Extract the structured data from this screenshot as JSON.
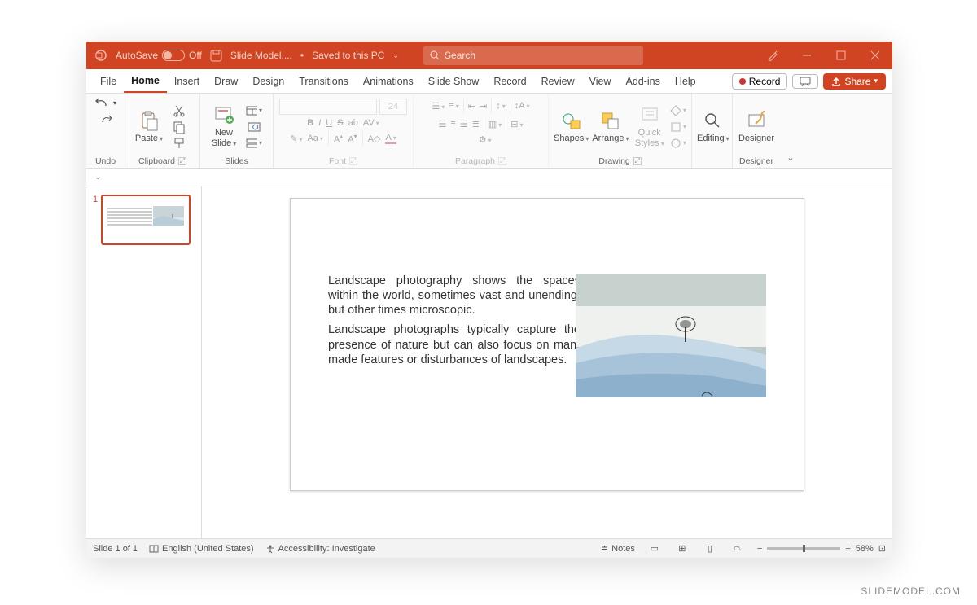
{
  "titlebar": {
    "autosave_label": "AutoSave",
    "autosave_state": "Off",
    "filename": "Slide Model....",
    "save_status": "Saved to this PC",
    "search_placeholder": "Search"
  },
  "tabs": {
    "file": "File",
    "home": "Home",
    "insert": "Insert",
    "draw": "Draw",
    "design": "Design",
    "transitions": "Transitions",
    "animations": "Animations",
    "slideshow": "Slide Show",
    "record": "Record",
    "review": "Review",
    "view": "View",
    "addins": "Add-ins",
    "help": "Help",
    "record_btn": "Record",
    "share_btn": "Share"
  },
  "ribbon": {
    "undo": "Undo",
    "clipboard": "Clipboard",
    "paste": "Paste",
    "slides": "Slides",
    "newslide": "New Slide",
    "font": "Font",
    "font_size": "24",
    "paragraph": "Paragraph",
    "drawing": "Drawing",
    "shapes": "Shapes",
    "arrange": "Arrange",
    "quickstyles": "Quick Styles",
    "editing": "Editing",
    "designer": "Designer",
    "designer_group": "Designer"
  },
  "slide": {
    "p1": "Landscape photography shows the spaces within the world, sometimes vast and unending, but other times microscopic.",
    "p2": "Landscape photographs typically capture the presence of nature but can also focus on man-made features or disturbances of landscapes."
  },
  "thumb": {
    "num": "1"
  },
  "status": {
    "slide": "Slide 1 of 1",
    "lang": "English (United States)",
    "access": "Accessibility: Investigate",
    "notes": "Notes",
    "zoom": "58%"
  },
  "watermark": "SLIDEMODEL.COM"
}
